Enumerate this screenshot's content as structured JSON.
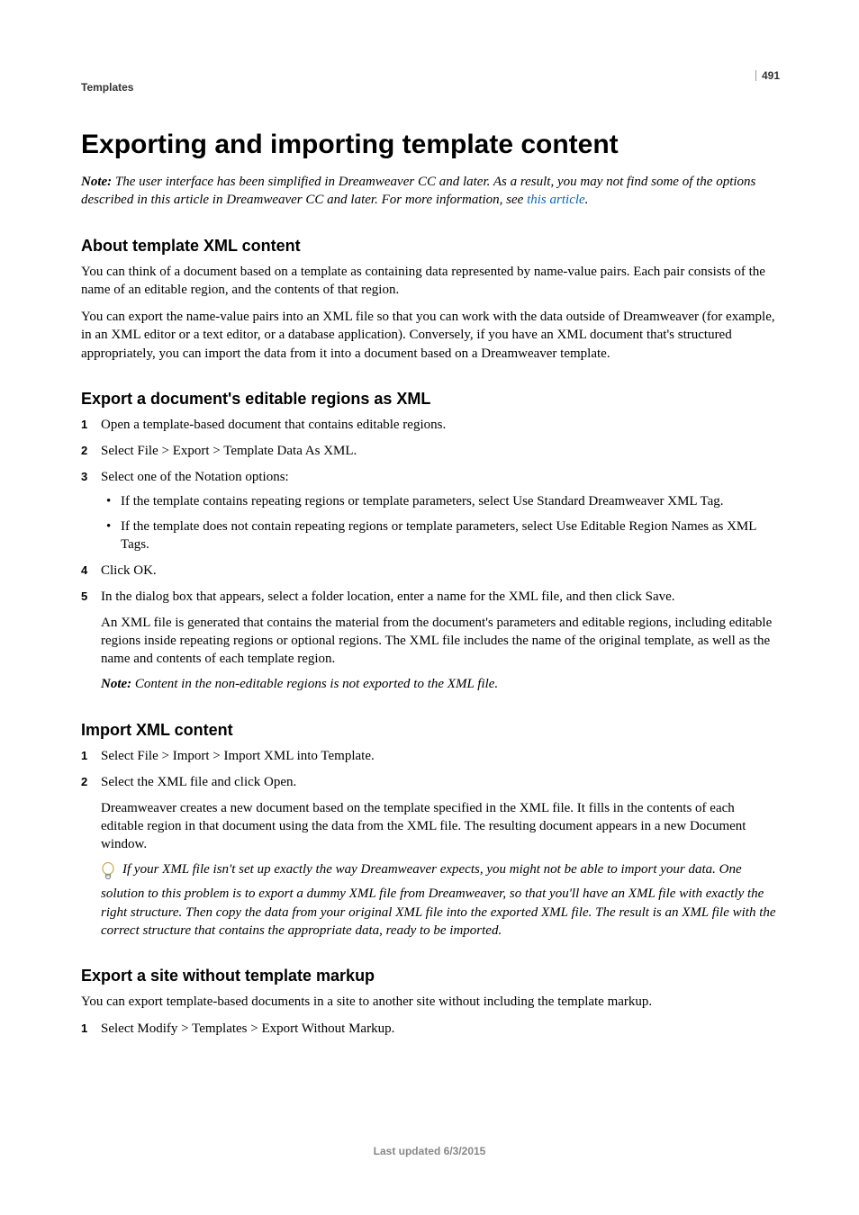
{
  "running_head": "Templates",
  "page_number": "491",
  "title": "Exporting and importing template content",
  "intro_note": {
    "label": "Note:",
    "text_before_link": " The user interface has been simplified in Dreamweaver CC and later. As a result, you may not find some of the options described in this article in Dreamweaver CC and later. For more information, see ",
    "link_text": "this article",
    "text_after_link": "."
  },
  "sections": {
    "about": {
      "heading": "About template XML content",
      "p1": "You can think of a document based on a template as containing data represented by name-value pairs. Each pair consists of the name of an editable region, and the contents of that region.",
      "p2": "You can export the name-value pairs into an XML file so that you can work with the data outside of Dreamweaver (for example, in an XML editor or a text editor, or a database application). Conversely, if you have an XML document that's structured appropriately, you can import the data from it into a document based on a Dreamweaver template."
    },
    "export_xml": {
      "heading": "Export a document's editable regions as XML",
      "steps": [
        "Open a template-based document that contains editable regions.",
        "Select File > Export > Template Data As XML.",
        "Select one of the Notation options:",
        "Click OK.",
        "In the dialog box that appears, select a folder location, enter a name for the XML file, and then click Save."
      ],
      "step3_bullets": [
        "If the template contains repeating regions or template parameters, select Use Standard Dreamweaver XML Tag.",
        "If the template does not contain repeating regions or template parameters, select Use Editable Region Names as XML Tags."
      ],
      "step5_followup": "An XML file is generated that contains the material from the document's parameters and editable regions, including editable regions inside repeating regions or optional regions. The XML file includes the name of the original template, as well as the name and contents of each template region.",
      "step5_note_label": "Note:",
      "step5_note_text": " Content in the non-editable regions is not exported to the XML file."
    },
    "import_xml": {
      "heading": "Import XML content",
      "steps": [
        "Select File > Import > Import XML into Template.",
        "Select the XML file and click Open."
      ],
      "step2_followup": "Dreamweaver creates a new document based on the template specified in the XML file. It fills in the contents of each editable region in that document using the data from the XML file. The resulting document appears in a new Document window.",
      "tip": "If your XML file isn't set up exactly the way Dreamweaver expects, you might not be able to import your data. One solution to this problem is to export a dummy XML file from Dreamweaver, so that you'll have an XML file with exactly the right structure. Then copy the data from your original XML file into the exported XML file. The result is an XML file with the correct structure that contains the appropriate data, ready to be imported."
    },
    "export_site": {
      "heading": "Export a site without template markup",
      "p1": "You can export template-based documents in a site to another site without including the template markup.",
      "steps": [
        "Select Modify > Templates > Export Without Markup."
      ]
    }
  },
  "footer": "Last updated 6/3/2015"
}
